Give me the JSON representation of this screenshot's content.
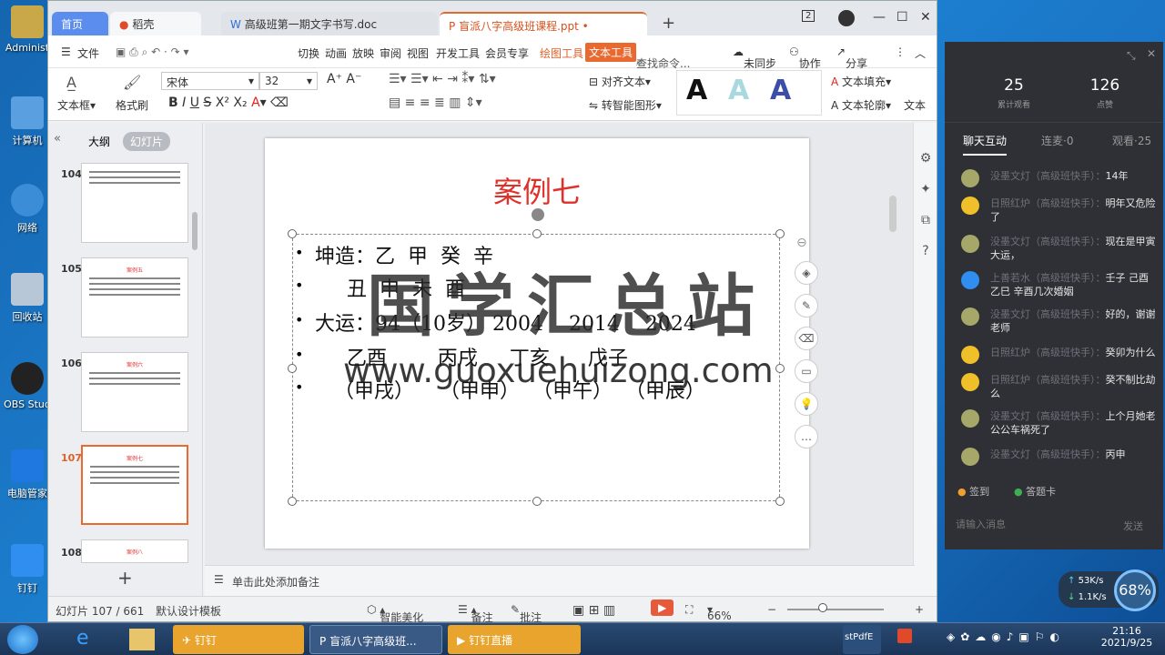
{
  "desktop": {
    "icons": [
      {
        "label": "Administ"
      },
      {
        "label": "计算机"
      },
      {
        "label": "网络"
      },
      {
        "label": "回收站"
      },
      {
        "label": "OBS Stud"
      },
      {
        "label": "电脑管家"
      },
      {
        "label": "钉钉"
      }
    ]
  },
  "tabs": {
    "home": "首页",
    "daoke": "稻壳",
    "doc": "高级班第一期文字书写.doc",
    "ppt": "盲派八字高级班课程.ppt",
    "badge": "2"
  },
  "menu": {
    "file": "文件",
    "items": [
      "切换",
      "动画",
      "放映",
      "审阅",
      "视图",
      "开发工具",
      "会员专享",
      "绘图工具",
      "文本工具"
    ],
    "search": "查找命令...",
    "sync": "未同步",
    "collab": "协作",
    "share": "分享"
  },
  "ribbon": {
    "textbox": "文本框",
    "format_painter": "格式刷",
    "font": "宋体",
    "size": "32",
    "align_text": "对齐文本",
    "smart_shape": "转智能图形",
    "text_fill": "文本填充",
    "text_outline": "文本轮廓",
    "text_effect": "文本"
  },
  "sidebar": {
    "outline_tab": "大纲",
    "slides_tab": "幻灯片",
    "slides": [
      {
        "num": "104",
        "title": ""
      },
      {
        "num": "105",
        "title": "案例五"
      },
      {
        "num": "106",
        "title": "案例六"
      },
      {
        "num": "107",
        "title": "案例七"
      },
      {
        "num": "108",
        "title": "案例八"
      }
    ]
  },
  "slide": {
    "title": "案例七",
    "lines": [
      "坤造：乙  甲  癸  辛",
      "     丑  申  未  酉",
      "大运：94（10岁） 2004    2014    2024",
      "     乙酉        丙戌     丁亥      戊子",
      "   （甲戌）    （甲申）  （甲午）  （甲辰）"
    ],
    "watermark": "国学汇总站",
    "watermark_url": "www.guoxuehuizong.com"
  },
  "notes": {
    "placeholder": "单击此处添加备注"
  },
  "status": {
    "slide_counter": "幻灯片 107 / 661",
    "template": "默认设计模板",
    "beautify": "智能美化",
    "notes": "备注",
    "comments": "批注",
    "zoom": "66%"
  },
  "live": {
    "viewers_count": "25",
    "viewers_label": "累计观看",
    "likes_count": "126",
    "likes_label": "点赞",
    "tab_chat": "聊天互动",
    "tab_mic": "连麦·0",
    "tab_watch": "观看·25",
    "messages": [
      {
        "name": "没墨文灯（高级班快手）：",
        "text": "14年"
      },
      {
        "name": "日照红炉（高级班快手）：",
        "text": "明年又危险了"
      },
      {
        "name": "没墨文灯（高级班快手）：",
        "text": "现在是甲寅大运，"
      },
      {
        "name": "上善若水（高级班快手）：",
        "text": "壬子 己酉 乙巳 辛酉几次婚姻"
      },
      {
        "name": "没墨文灯（高级班快手）：",
        "text": "好的，谢谢老师"
      },
      {
        "name": "日照红炉（高级班快手）：",
        "text": "癸卯为什么"
      },
      {
        "name": "日照红炉（高级班快手）：",
        "text": "癸不制比劫么"
      },
      {
        "name": "没墨文灯（高级班快手）：",
        "text": "上个月她老公公车祸死了"
      },
      {
        "name": "没墨文灯（高级班快手）：",
        "text": "丙申"
      }
    ],
    "signin": "签到",
    "answer_card": "答题卡",
    "input_placeholder": "请输入消息",
    "send": "发送"
  },
  "taskbar": {
    "dingding": "钉钉",
    "ppt_window": "盲派八字高级班...",
    "live": "钉钉直播",
    "pdf": "stPdfE",
    "time": "21:16",
    "date": "2021/9/25"
  },
  "netspeed": {
    "up": "53K/s",
    "down": "1.1K/s",
    "cpu": "68%"
  }
}
